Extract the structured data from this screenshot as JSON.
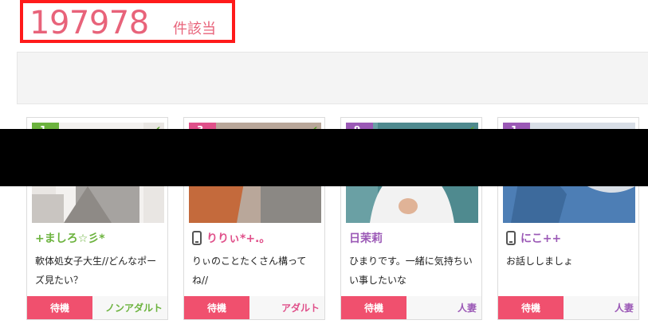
{
  "result": {
    "count": "197978",
    "suffix": "件該当"
  },
  "cards": [
    {
      "rank": "1",
      "name": "+ましろ☆彡*",
      "name_color": "#6cb33e",
      "has_phone": false,
      "description": "軟体処女子大生//どんなポーズ見たい？",
      "status": "待機",
      "category": "ノンアダルト",
      "category_color": "#6cb33e",
      "rank_color": "#6cb33e"
    },
    {
      "rank": "3",
      "name": "りりぃ*+.｡",
      "name_color": "#e0508a",
      "has_phone": true,
      "description": "りぃのことたくさん構ってね//",
      "status": "待機",
      "category": "アダルト",
      "category_color": "#e0508a",
      "rank_color": "#e0508a"
    },
    {
      "rank": "9",
      "name": "日茉莉",
      "name_color": "#9b59b6",
      "has_phone": false,
      "description": "ひまりです。一緒に気持ちいい事したいな",
      "status": "待機",
      "category": "人妻",
      "category_color": "#9b59b6",
      "rank_color": "#9b59b6"
    },
    {
      "rank": "1",
      "name": "にこ++",
      "name_color": "#9b59b6",
      "has_phone": true,
      "description": "お話ししましょ",
      "status": "待機",
      "category": "人妻",
      "category_color": "#9b59b6",
      "rank_color": "#9b59b6"
    }
  ]
}
